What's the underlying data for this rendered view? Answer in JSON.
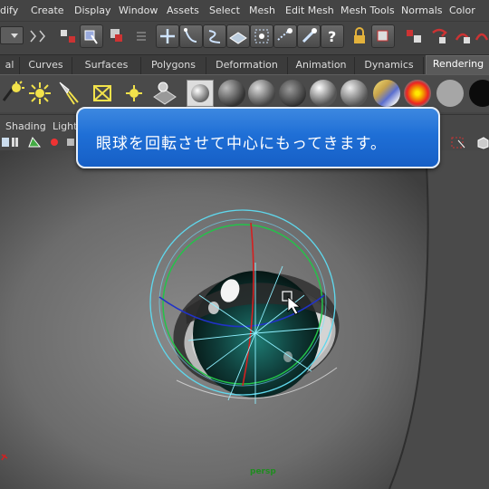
{
  "menu": [
    "dify",
    "Create",
    "Display",
    "Window",
    "Assets",
    "Select",
    "Mesh",
    "Edit Mesh",
    "Mesh Tools",
    "Normals",
    "Color"
  ],
  "shelf_tabs": [
    {
      "label": "al",
      "active": false
    },
    {
      "label": "Curves",
      "active": false
    },
    {
      "label": "Surfaces",
      "active": false
    },
    {
      "label": "Polygons",
      "active": false
    },
    {
      "label": "Deformation",
      "active": false
    },
    {
      "label": "Animation",
      "active": false
    },
    {
      "label": "Dynamics",
      "active": false
    },
    {
      "label": "Rendering",
      "active": true
    }
  ],
  "panel_menus": [
    "Shading",
    "Light"
  ],
  "viewport": {
    "camera_label": "persp"
  },
  "tooltip": {
    "text": "眼球を回転させて中心にもってきます。"
  },
  "colors": {
    "accent_blue": "#1f6fd6",
    "manip_green": "#22c24a",
    "manip_cyan": "#58d4e8",
    "manip_red": "#d82020"
  }
}
